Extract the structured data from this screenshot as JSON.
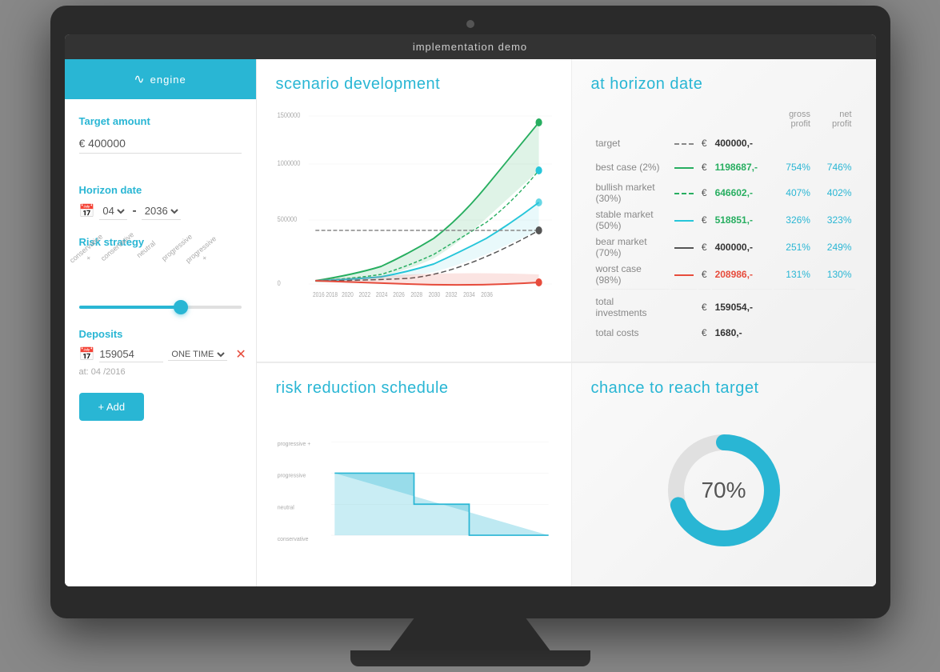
{
  "title_bar": {
    "text": "implementation demo"
  },
  "brand": {
    "label": "engine",
    "icon": "∿"
  },
  "sidebar": {
    "target_amount_label": "Target amount",
    "target_amount_value": "€ 400000",
    "horizon_date_label": "Horizon date",
    "horizon_month": "04",
    "horizon_year": "2036",
    "risk_strategy_label": "Risk strategy",
    "risk_labels": [
      "conservative +",
      "conservative",
      "neutral",
      "progressive",
      "progressive +"
    ],
    "deposits_label": "Deposits",
    "deposit_value": "159054",
    "deposit_type": "ONE TIME",
    "deposit_date": "at: 04 /2016",
    "add_button_label": "+ Add"
  },
  "scenario_development": {
    "title": "scenario development",
    "y_labels": [
      "1500000",
      "1000000",
      "500000",
      "0"
    ],
    "x_labels": [
      "2016",
      "2018",
      "2020",
      "2022",
      "2024",
      "2026",
      "2028",
      "2030",
      "2032",
      "2034",
      "2036"
    ]
  },
  "at_horizon": {
    "title": "at horizon date",
    "header": {
      "col1": "gross profit",
      "col2": "net profit"
    },
    "rows": [
      {
        "label": "target",
        "line_type": "dashed",
        "currency": "€",
        "amount": "400000,-",
        "color": "neutral",
        "gross": "",
        "net": ""
      },
      {
        "label": "best case (2%)",
        "line_type": "solid-green",
        "currency": "€",
        "amount": "1198687,-",
        "color": "green",
        "gross": "754%",
        "net": "746%"
      },
      {
        "label": "bullish market (30%)",
        "line_type": "dashed-green",
        "currency": "€",
        "amount": "646602,-",
        "color": "green",
        "gross": "407%",
        "net": "402%"
      },
      {
        "label": "stable market (50%)",
        "line_type": "solid-teal",
        "currency": "€",
        "amount": "518851,-",
        "color": "green",
        "gross": "326%",
        "net": "323%"
      },
      {
        "label": "bear market (70%)",
        "line_type": "solid-dark",
        "currency": "€",
        "amount": "400000,-",
        "color": "neutral",
        "gross": "251%",
        "net": "249%"
      },
      {
        "label": "worst case (98%)",
        "line_type": "solid-red",
        "currency": "€",
        "amount": "208986,-",
        "color": "red",
        "gross": "131%",
        "net": "130%"
      }
    ],
    "totals": [
      {
        "label": "total investments",
        "currency": "€",
        "amount": "159054,-"
      },
      {
        "label": "total costs",
        "currency": "€",
        "amount": "1680,-"
      }
    ]
  },
  "risk_reduction": {
    "title": "risk reduction schedule",
    "y_labels": [
      "progressive +",
      "progressive",
      "neutral",
      "conservative"
    ]
  },
  "chance_to_reach": {
    "title": "chance to reach target",
    "percentage": "70%",
    "donut_value": 70
  }
}
